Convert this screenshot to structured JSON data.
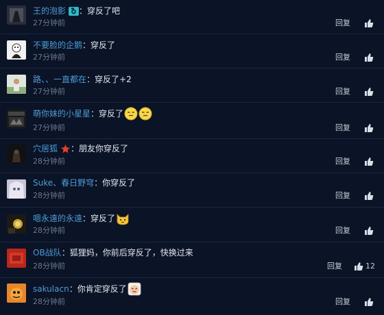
{
  "reply_label": "回复",
  "separator": "：",
  "comments": [
    {
      "user": "王的泡影",
      "text": "穿反了吧",
      "time": "27分钟前"
    },
    {
      "user": "不要脸的企鹅",
      "text": "穿反了",
      "time": "27分钟前"
    },
    {
      "user": "路、、一直都在",
      "text": "穿反了+2",
      "time": "27分钟前"
    },
    {
      "user": "萌你妹的小星星",
      "text": "穿反了",
      "time": "27分钟前"
    },
    {
      "user": "穴居狐",
      "text": "朋友你穿反了",
      "time": "28分钟前"
    },
    {
      "user": "Suke、春日野穹",
      "text": "你穿反了",
      "time": "28分钟前"
    },
    {
      "user": "嗯永遠的永遠",
      "text": "穿反了",
      "time": "28分钟前"
    },
    {
      "user": "OB战队",
      "text": "狐狸妈，你前后穿反了，快换过来",
      "time": "28分钟前",
      "likes": "12"
    },
    {
      "user": "sakulacn",
      "text": "你肯定穿反了",
      "time": "28分钟前"
    }
  ],
  "colors": {
    "background": "#0b1326",
    "username": "#4d9bd6",
    "timestamp": "#6c7891",
    "separator_line": "#1c263d"
  }
}
